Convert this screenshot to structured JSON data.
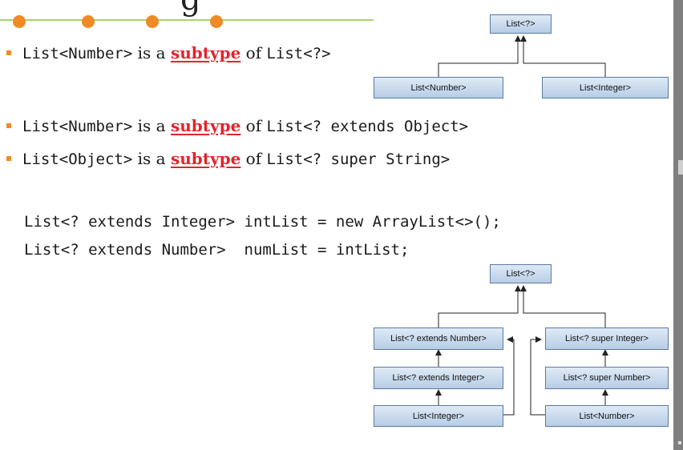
{
  "slide": {
    "title_fragment": "g",
    "bullets": [
      {
        "code_a": "List<Number>",
        "text_is": " is a ",
        "keyword": "subtype",
        "text_of": " of ",
        "code_b": "List<?>"
      },
      {
        "code_a": "List<Number>",
        "text_is": " is a ",
        "keyword": "subtype",
        "text_of": " of ",
        "code_b": "List<? extends Object>"
      },
      {
        "code_a": "List<Object>",
        "text_is": " is a ",
        "keyword": "subtype",
        "text_of": " of ",
        "code_b": "List<? super String>"
      }
    ],
    "code_lines": [
      "List<? extends Integer> intList = new ArrayList<>();",
      "List<? extends Number>  numList = intList;"
    ]
  },
  "diagram_top": {
    "root": "List<?>",
    "left": "List<Number>",
    "right": "List<Integer>"
  },
  "diagram_bottom": {
    "root": "List<?>",
    "left_col": [
      "List<? extends Number>",
      "List<? extends Integer>",
      "List<Integer>"
    ],
    "right_col": [
      "List<? super Integer>",
      "List<? super Number>",
      "List<Number>"
    ]
  },
  "colors": {
    "accent": "#f08a24",
    "keyword": "#e4232c",
    "rule_line": "#8cc63f",
    "box_border": "#5b7aa0",
    "box_fill_top": "#dfeaf6",
    "box_fill_bottom": "#b7cde6"
  }
}
